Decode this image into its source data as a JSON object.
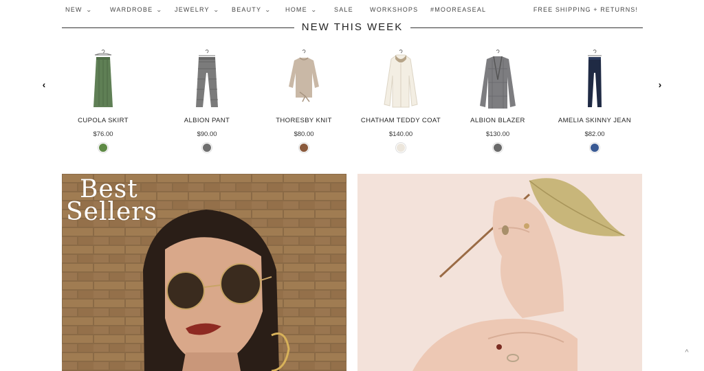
{
  "nav": {
    "items": [
      {
        "label": "NEW",
        "has_dropdown": true
      },
      {
        "label": "WARDROBE",
        "has_dropdown": true
      },
      {
        "label": "JEWELRY",
        "has_dropdown": true
      },
      {
        "label": "BEAUTY",
        "has_dropdown": true
      },
      {
        "label": "HOME",
        "has_dropdown": true
      },
      {
        "label": "SALE",
        "has_dropdown": false
      },
      {
        "label": "WORKSHOPS",
        "has_dropdown": false
      },
      {
        "label": "#MOOREASEAL",
        "has_dropdown": false
      }
    ],
    "chevron": "⌄",
    "promo": "FREE SHIPPING + RETURNS!"
  },
  "section": {
    "title": "NEW THIS WEEK"
  },
  "carousel": {
    "prev_icon": "‹",
    "next_icon": "›"
  },
  "products": [
    {
      "name": "CUPOLA SKIRT",
      "price": "$76.00",
      "swatch": "#5e8a45"
    },
    {
      "name": "ALBION PANT",
      "price": "$90.00",
      "swatch": "#6f6f6f"
    },
    {
      "name": "THORESBY KNIT",
      "price": "$80.00",
      "swatch": "#8a5a3c"
    },
    {
      "name": "CHATHAM TEDDY COAT",
      "price": "$140.00",
      "swatch": "#ece6dc"
    },
    {
      "name": "ALBION BLAZER",
      "price": "$130.00",
      "swatch": "#6a6a6a"
    },
    {
      "name": "AMELIA SKINNY JEAN",
      "price": "$82.00",
      "swatch": "#3a5a94"
    }
  ],
  "banners": {
    "best_sellers_line1": "Best",
    "best_sellers_line2": "Sellers"
  },
  "scroll_top_icon": "^"
}
